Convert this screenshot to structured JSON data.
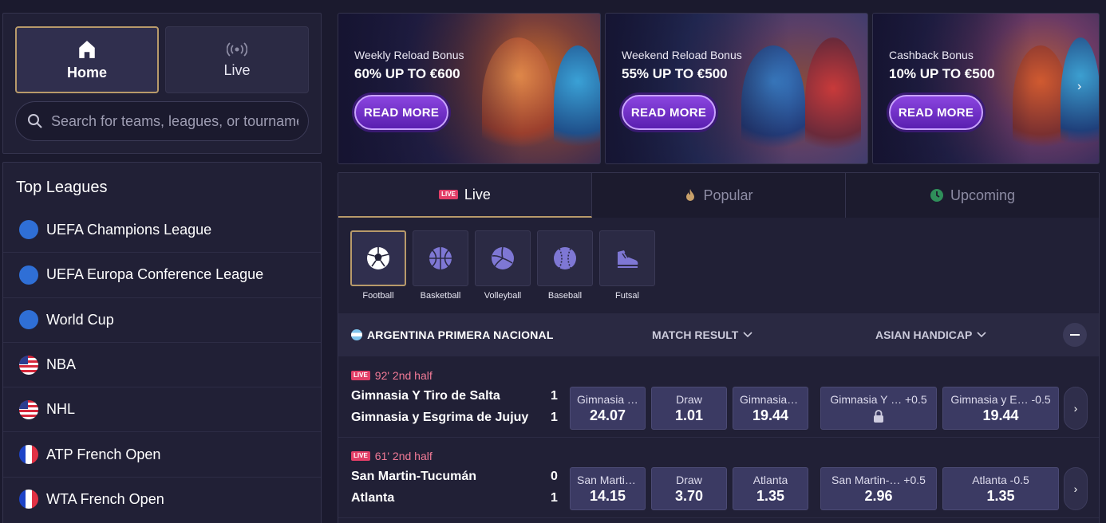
{
  "nav": {
    "home_label": "Home",
    "live_label": "Live",
    "search_placeholder": "Search for teams, leagues, or tournaments"
  },
  "top_leagues": {
    "title": "Top Leagues",
    "items": [
      {
        "label": "UEFA Champions League",
        "flag": "world"
      },
      {
        "label": "UEFA Europa Conference League",
        "flag": "world"
      },
      {
        "label": "World Cup",
        "flag": "world"
      },
      {
        "label": "NBA",
        "flag": "us"
      },
      {
        "label": "NHL",
        "flag": "us"
      },
      {
        "label": "ATP French Open",
        "flag": "fr"
      },
      {
        "label": "WTA French Open",
        "flag": "fr"
      }
    ]
  },
  "banners": [
    {
      "subtitle": "Weekly Reload Bonus",
      "headline": "60% UP TO €600",
      "button": "READ MORE"
    },
    {
      "subtitle": "Weekend Reload Bonus",
      "headline": "55% UP TO €500",
      "button": "READ MORE"
    },
    {
      "subtitle": "Cashback Bonus",
      "headline": "10% UP TO €500",
      "button": "READ MORE"
    }
  ],
  "tabs": {
    "live_badge": "LIVE",
    "live": "Live",
    "popular": "Popular",
    "upcoming": "Upcoming"
  },
  "sports": [
    {
      "label": "Football",
      "icon": "soccer-ball-icon"
    },
    {
      "label": "Basketball",
      "icon": "basketball-icon"
    },
    {
      "label": "Volleyball",
      "icon": "volleyball-icon"
    },
    {
      "label": "Baseball",
      "icon": "baseball-icon"
    },
    {
      "label": "Futsal",
      "icon": "futsal-shoe-icon"
    }
  ],
  "league_bar": {
    "name": "ARGENTINA PRIMERA NACIONAL",
    "market1": "MATCH RESULT",
    "market2": "ASIAN HANDICAP"
  },
  "matches": [
    {
      "status": "92' 2nd half",
      "home": "Gimnasia Y Tiro de Salta",
      "away": "Gimnasia y Esgrima de Jujuy",
      "home_score": "1",
      "away_score": "1",
      "odds": [
        {
          "label": "Gimnasia Y Tiro de Salta",
          "value": "24.07"
        },
        {
          "label": "Draw",
          "value": "1.01"
        },
        {
          "label": "Gimnasia y Esgrima de Jujuy",
          "value": "19.44"
        },
        {
          "label": "Gimnasia Y … +0.5",
          "value": "",
          "locked": true
        },
        {
          "label": "Gimnasia y E… -0.5",
          "value": "19.44"
        }
      ]
    },
    {
      "status": "61' 2nd half",
      "home": "San Martin-Tucumán",
      "away": "Atlanta",
      "home_score": "0",
      "away_score": "1",
      "odds": [
        {
          "label": "San Martin-Tucumán",
          "value": "14.15"
        },
        {
          "label": "Draw",
          "value": "3.70"
        },
        {
          "label": "Atlanta",
          "value": "1.35"
        },
        {
          "label": "San Martin-… +0.5",
          "value": "2.96"
        },
        {
          "label": "Atlanta -0.5",
          "value": "1.35"
        }
      ]
    }
  ]
}
